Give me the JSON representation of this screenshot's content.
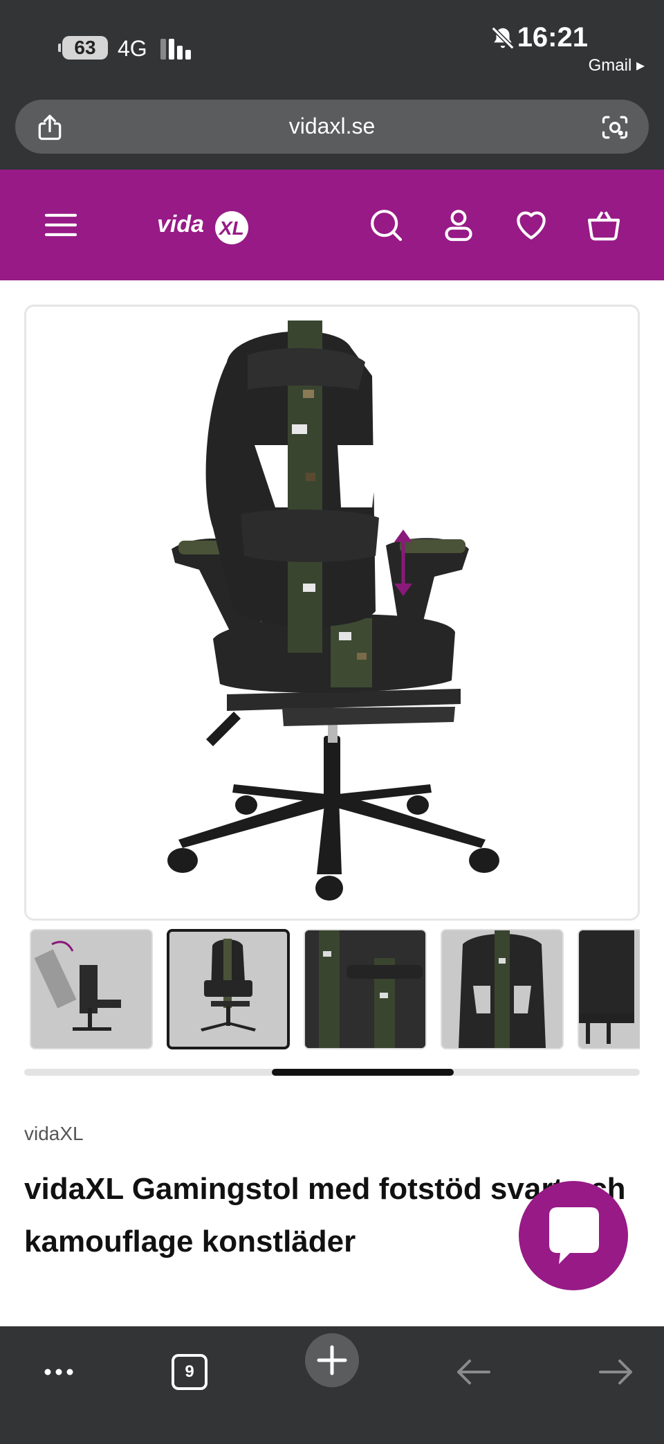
{
  "status_bar": {
    "battery": "63",
    "network": "4G",
    "time": "16:21",
    "notification_app": "Gmail ▸"
  },
  "browser": {
    "url": "vidaxl.se",
    "tab_count": "9"
  },
  "site_header": {
    "logo_text": "vidaXL",
    "brand_color": "#971a86"
  },
  "product": {
    "brand": "vidaXL",
    "title": "vidaXL Gamingstol med fotstöd svart och kamouflage konstläder"
  },
  "gallery": {
    "thumbnail_count": 5,
    "active_thumbnail": 2,
    "scroll_position": 0.5
  },
  "icons": {
    "header": [
      "menu-icon",
      "search-icon",
      "account-icon",
      "wishlist-heart-icon",
      "cart-basket-icon"
    ],
    "browser_bottom": [
      "more-dots-icon",
      "tabs-icon",
      "new-tab-plus-icon",
      "back-arrow-icon",
      "forward-arrow-icon"
    ]
  }
}
